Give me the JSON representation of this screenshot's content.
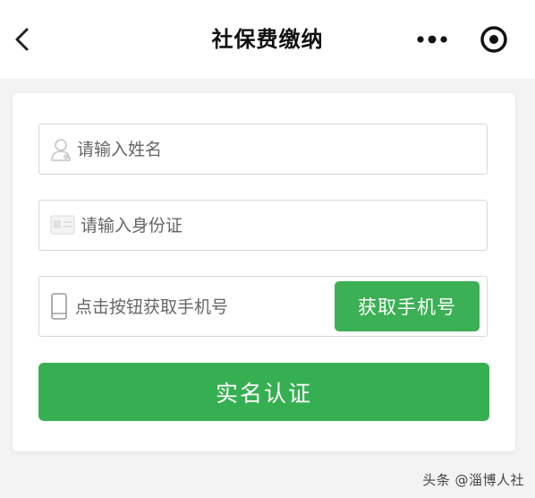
{
  "nav": {
    "title": "社保费缴纳",
    "back_icon": "chevron-left-icon",
    "more_icon": "more-dots-icon",
    "target_icon": "target-icon"
  },
  "form": {
    "name_field": {
      "placeholder": "请输入姓名",
      "value": "",
      "icon": "user-icon"
    },
    "id_field": {
      "placeholder": "请输入身份证",
      "value": "",
      "icon": "id-card-icon"
    },
    "phone_field": {
      "placeholder": "点击按钮获取手机号",
      "value": "",
      "icon": "phone-icon"
    },
    "get_phone_label": "获取手机号",
    "verify_label": "实名认证"
  },
  "watermark": "头条 @淄博人社",
  "colors": {
    "primary_green": "#3bb054",
    "background": "#f3f3f3",
    "field_border": "#d8d8d8"
  }
}
